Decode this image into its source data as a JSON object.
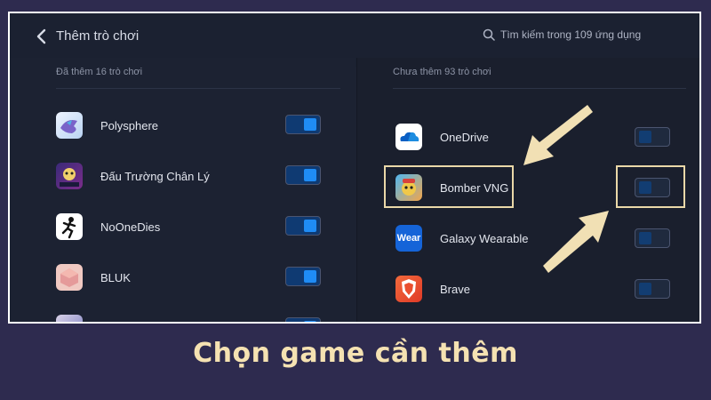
{
  "header": {
    "title": "Thêm trò chơi",
    "search_placeholder": "Tìm kiếm trong 109 ứng dụng"
  },
  "left_panel": {
    "section_label": "Đã thêm 16 trò chơi",
    "items": [
      {
        "label": "Polysphere",
        "toggle": "on",
        "icon": "polysphere-icon"
      },
      {
        "label": "Đấu Trường Chân Lý",
        "toggle": "on",
        "icon": "tft-icon"
      },
      {
        "label": "NoOneDies",
        "toggle": "on",
        "icon": "noonedies-icon"
      },
      {
        "label": "BLUK",
        "toggle": "on",
        "icon": "bluk-icon"
      },
      {
        "label": "",
        "toggle": "on",
        "icon": "partial-app-icon"
      }
    ]
  },
  "right_panel": {
    "section_label": "Chưa thêm 93 trò chơi",
    "items": [
      {
        "label": "OneDrive",
        "toggle": "off",
        "icon": "onedrive-icon"
      },
      {
        "label": "Bomber VNG",
        "toggle": "off",
        "icon": "bomber-vng-icon"
      },
      {
        "label": "Galaxy Wearable",
        "toggle": "off",
        "icon": "wear-icon",
        "icon_text": "Wear"
      },
      {
        "label": "Brave",
        "toggle": "off",
        "icon": "brave-icon"
      }
    ]
  },
  "caption": "Chọn game cần thêm",
  "colors": {
    "background": "#2e2b4f",
    "panel": "#1c2232",
    "accent": "#1f8cf5",
    "highlight": "#ead8a8",
    "caption": "#f5e2b2"
  }
}
